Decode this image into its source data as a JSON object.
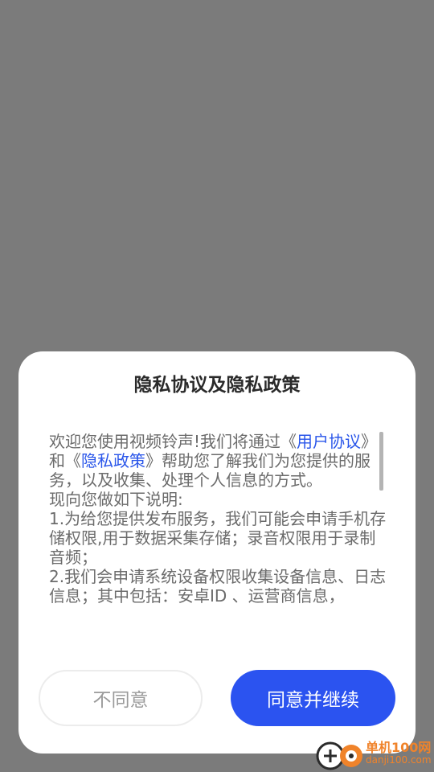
{
  "dialog": {
    "title": "隐私协议及隐私政策",
    "content": {
      "p1_prefix": "欢迎您使用视频铃声!我们将通过《",
      "link_user_agreement": "用户协议",
      "p1_mid": "》和《",
      "link_privacy_policy": "隐私政策",
      "p1_suffix": "》帮助您了解我们为您提供的服务，以及收集、处理个人信息的方式。",
      "p2": "现向您做如下说明:",
      "p3": "1.为给您提供发布服务，我们可能会申请手机存储权限,用于数据采集存储；录音权限用于录制音频；",
      "p4": "2.我们会申请系统设备权限收集设备信息、日志信息；其中包括：安卓ID 、运营商信息，"
    },
    "buttons": {
      "disagree": "不同意",
      "agree": "同意并继续"
    }
  },
  "watermark": {
    "brand": "单机100网",
    "url": "danji100.com"
  },
  "colors": {
    "overlay": "#7b7b7b",
    "accent": "#2b53f0",
    "link": "#2a56ea",
    "watermark": "#f0832a"
  }
}
